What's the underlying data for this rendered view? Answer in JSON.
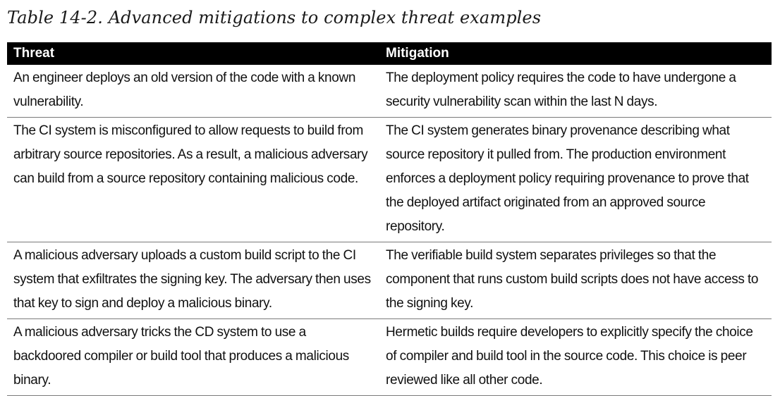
{
  "caption": "Table 14-2. Advanced mitigations to complex threat examples",
  "table": {
    "headers": [
      "Threat",
      "Mitigation"
    ],
    "rows": [
      {
        "threat": "An engineer deploys an old version of the code with a known vulnerability.",
        "mitigation": "The deployment policy requires the code to have undergone a security vulnerability scan within the last N days."
      },
      {
        "threat": "The CI system is misconfigured to allow requests to build from arbitrary source repositories. As a result, a malicious adversary can build from a source repository containing malicious code.",
        "mitigation": "The CI system generates binary provenance describing what source repository it pulled from. The production environment enforces a deployment policy requiring provenance to prove that the deployed artifact originated from an approved source repository."
      },
      {
        "threat": "A malicious adversary uploads a custom build script to the CI system that exfiltrates the signing key. The adversary then uses that key to sign and deploy a malicious binary.",
        "mitigation": "The verifiable build system separates privileges so that the component that runs custom build scripts does not have access to the signing key."
      },
      {
        "threat": "A malicious adversary tricks the CD system to use a backdoored compiler or build tool that produces a malicious binary.",
        "mitigation": "Hermetic builds require developers to explicitly specify the choice of compiler and build tool in the source code. This choice is peer reviewed like all other code."
      }
    ]
  }
}
